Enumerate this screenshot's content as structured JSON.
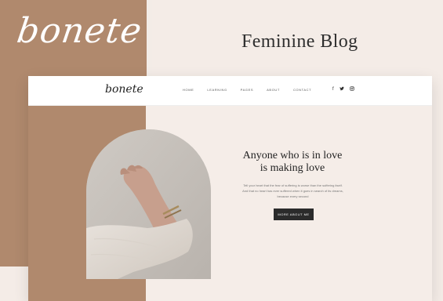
{
  "hero": {
    "brand": "bonete",
    "title": "Feminine Blog"
  },
  "header": {
    "logo": "bonete",
    "nav": [
      "HOME",
      "LEARNING",
      "PAGES",
      "ABOUT",
      "CONTACT"
    ],
    "social": [
      "f",
      "t",
      "ig"
    ]
  },
  "main": {
    "headline_line1": "Anyone who is in love",
    "headline_line2": "is making love",
    "paragraph_line1": "Tell your heart that the fear of suffering is worse than the suffering itself.",
    "paragraph_line2": "And that no heart has ever suffered when it goes in search of its dreams,",
    "paragraph_line3": "because every second",
    "cta_label": "MORE ABOUT ME"
  },
  "colors": {
    "tan": "#b0896d",
    "light": "#f4ece7",
    "dark": "#2b2b2b"
  }
}
